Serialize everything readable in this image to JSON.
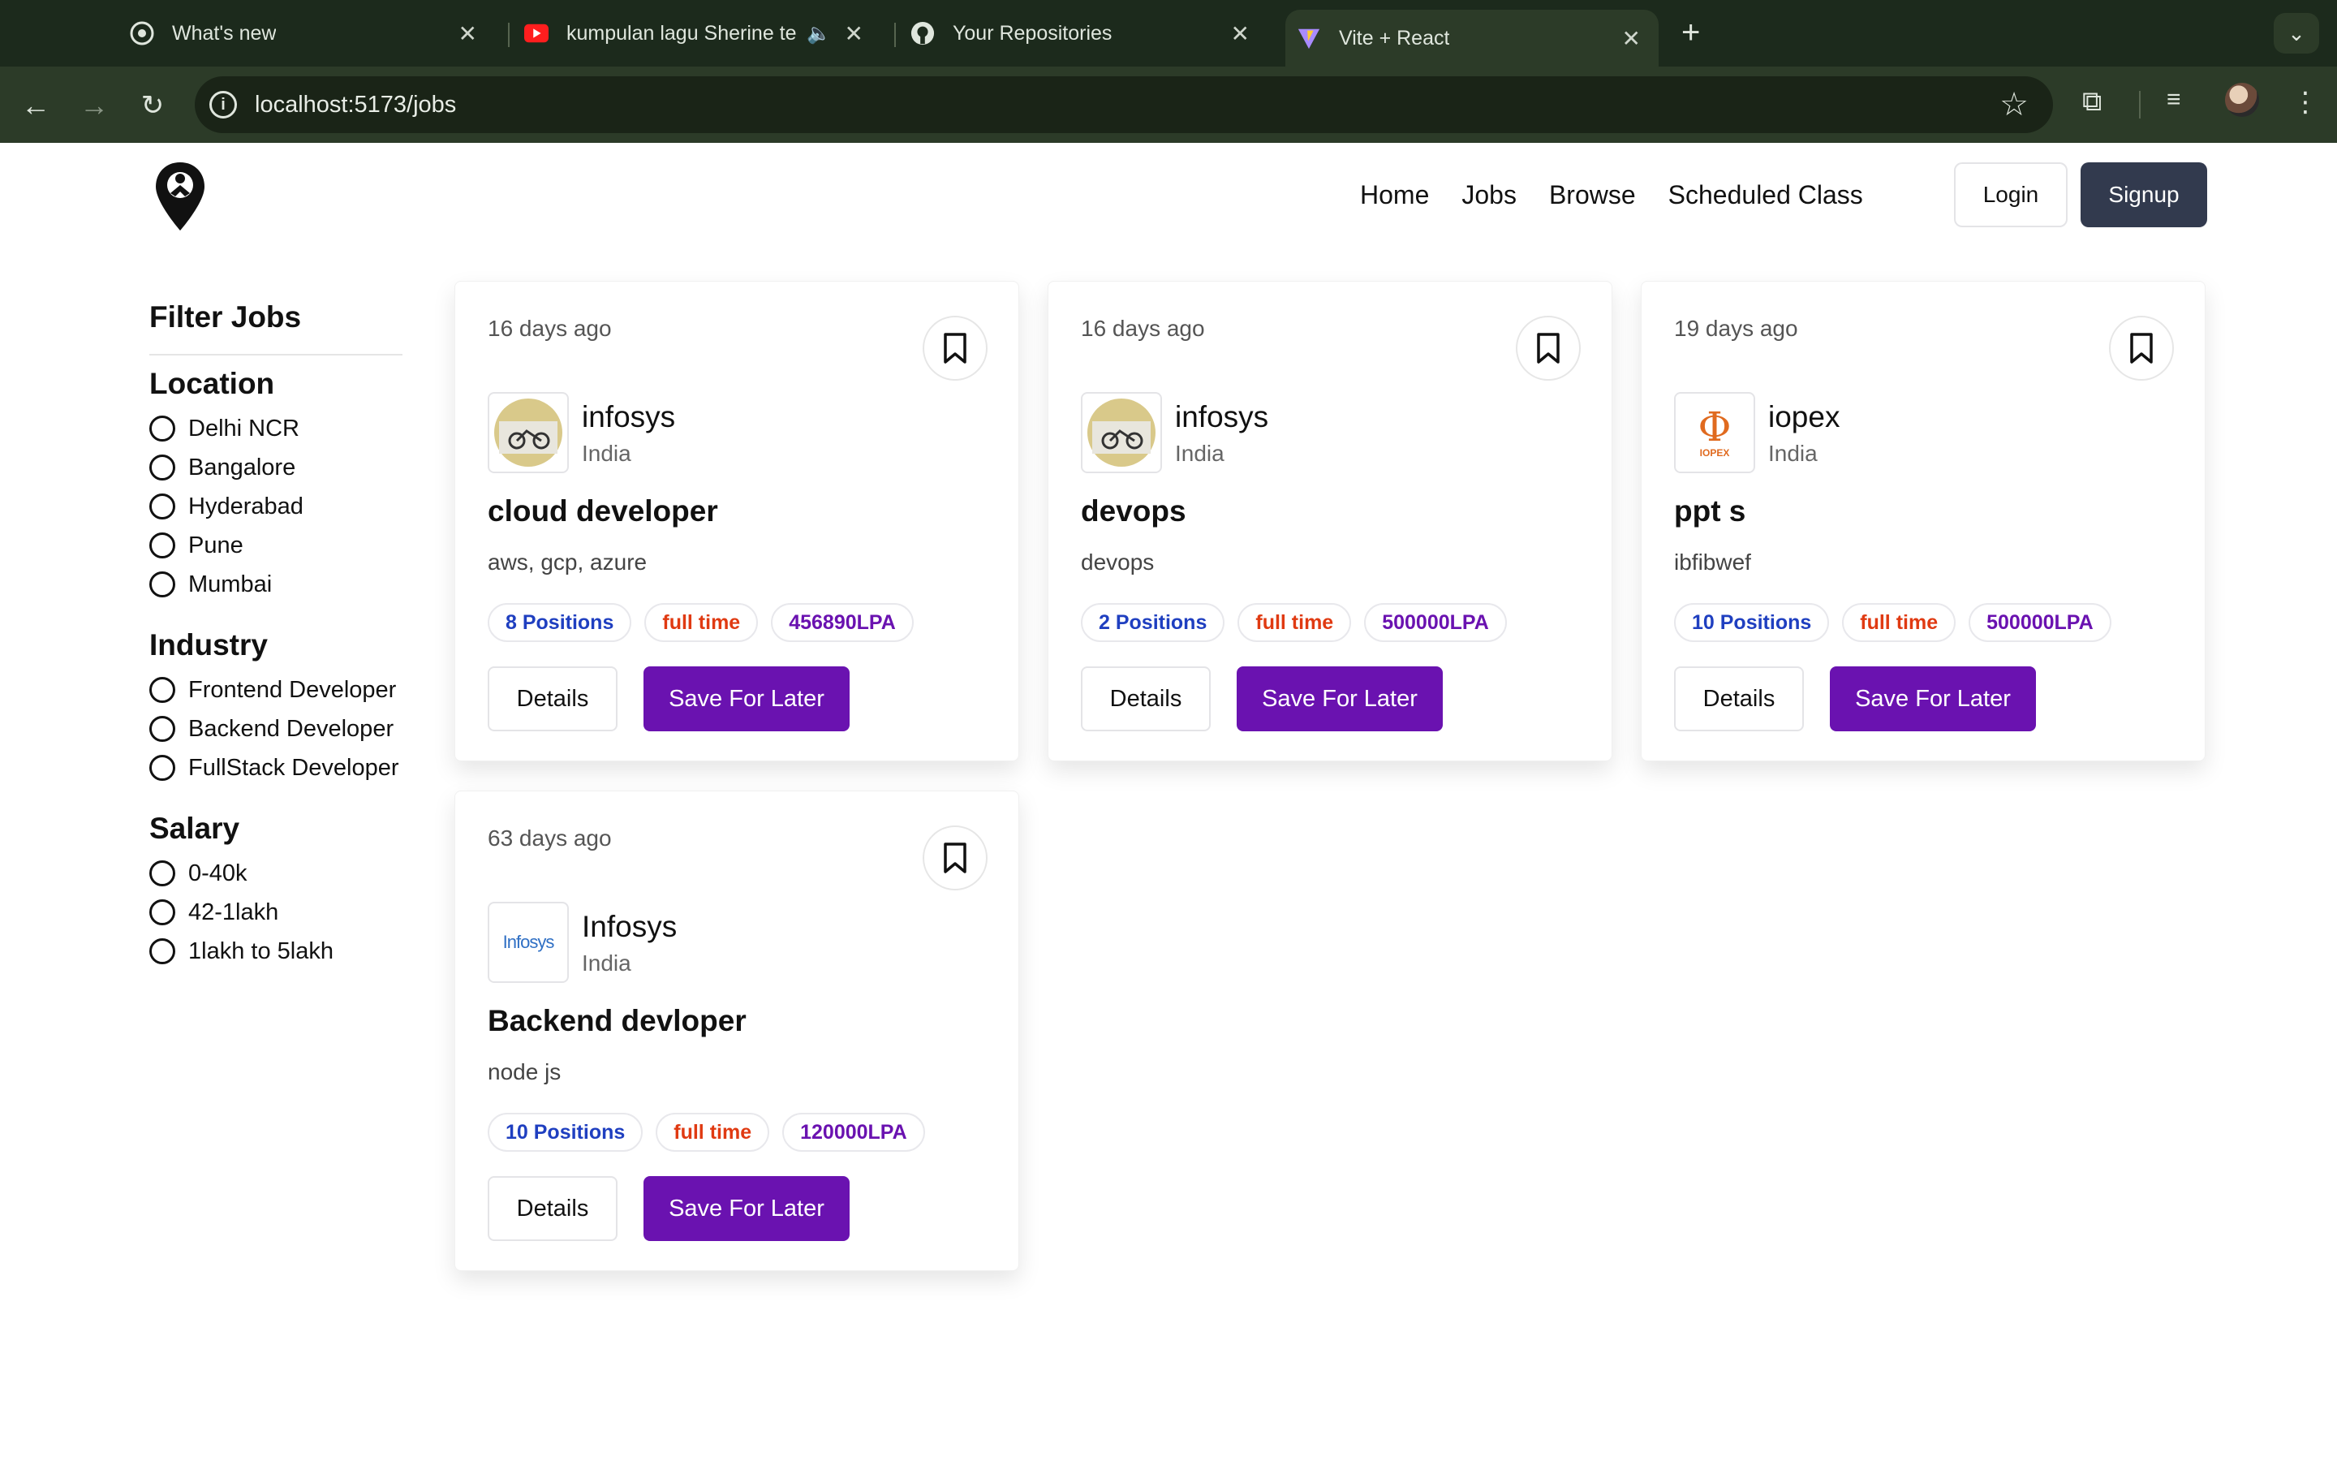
{
  "browser": {
    "tabs": [
      {
        "title": "What's new",
        "icon": "chrome-icon",
        "active": false
      },
      {
        "title": "kumpulan lagu Sherine te",
        "icon": "youtube-icon",
        "active": false,
        "audio": true
      },
      {
        "title": "Your Repositories",
        "icon": "github-icon",
        "active": false
      },
      {
        "title": "Vite + React",
        "icon": "vite-icon",
        "active": true
      }
    ],
    "url": "localhost:5173/jobs"
  },
  "header": {
    "nav": [
      "Home",
      "Jobs",
      "Browse",
      "Scheduled Class"
    ],
    "login_label": "Login",
    "signup_label": "Signup",
    "accent": "#323a4e"
  },
  "filters": {
    "title": "Filter Jobs",
    "groups": [
      {
        "name": "Location",
        "options": [
          "Delhi NCR",
          "Bangalore",
          "Hyderabad",
          "Pune",
          "Mumbai"
        ]
      },
      {
        "name": "Industry",
        "options": [
          "Frontend Developer",
          "Backend Developer",
          "FullStack Developer"
        ]
      },
      {
        "name": "Salary",
        "options": [
          "0-40k",
          "42-1lakh",
          "1lakh to 5lakh"
        ]
      }
    ]
  },
  "jobs": [
    {
      "posted": "16 days ago",
      "company": "infosys",
      "location": "India",
      "title": "cloud developer",
      "description": "aws, gcp, azure",
      "positions": "8 Positions",
      "job_type": "full time",
      "salary": "456890LPA",
      "logo": "bike-photo"
    },
    {
      "posted": "16 days ago",
      "company": "infosys",
      "location": "India",
      "title": "devops",
      "description": "devops",
      "positions": "2 Positions",
      "job_type": "full time",
      "salary": "500000LPA",
      "logo": "bike-photo"
    },
    {
      "posted": "19 days ago",
      "company": "iopex",
      "location": "India",
      "title": "ppt s",
      "description": "ibfibwef",
      "positions": "10 Positions",
      "job_type": "full time",
      "salary": "500000LPA",
      "logo": "iopex-logo",
      "logo_text": "IOPEX"
    },
    {
      "posted": "63 days ago",
      "company": "Infosys",
      "location": "India",
      "title": "Backend devloper",
      "description": "node js",
      "positions": "10 Positions",
      "job_type": "full time",
      "salary": "120000LPA",
      "logo": "infosys-logo",
      "logo_text": "Infosys"
    }
  ],
  "actions": {
    "details_label": "Details",
    "save_label": "Save For Later",
    "save_color": "#6a12b0"
  }
}
